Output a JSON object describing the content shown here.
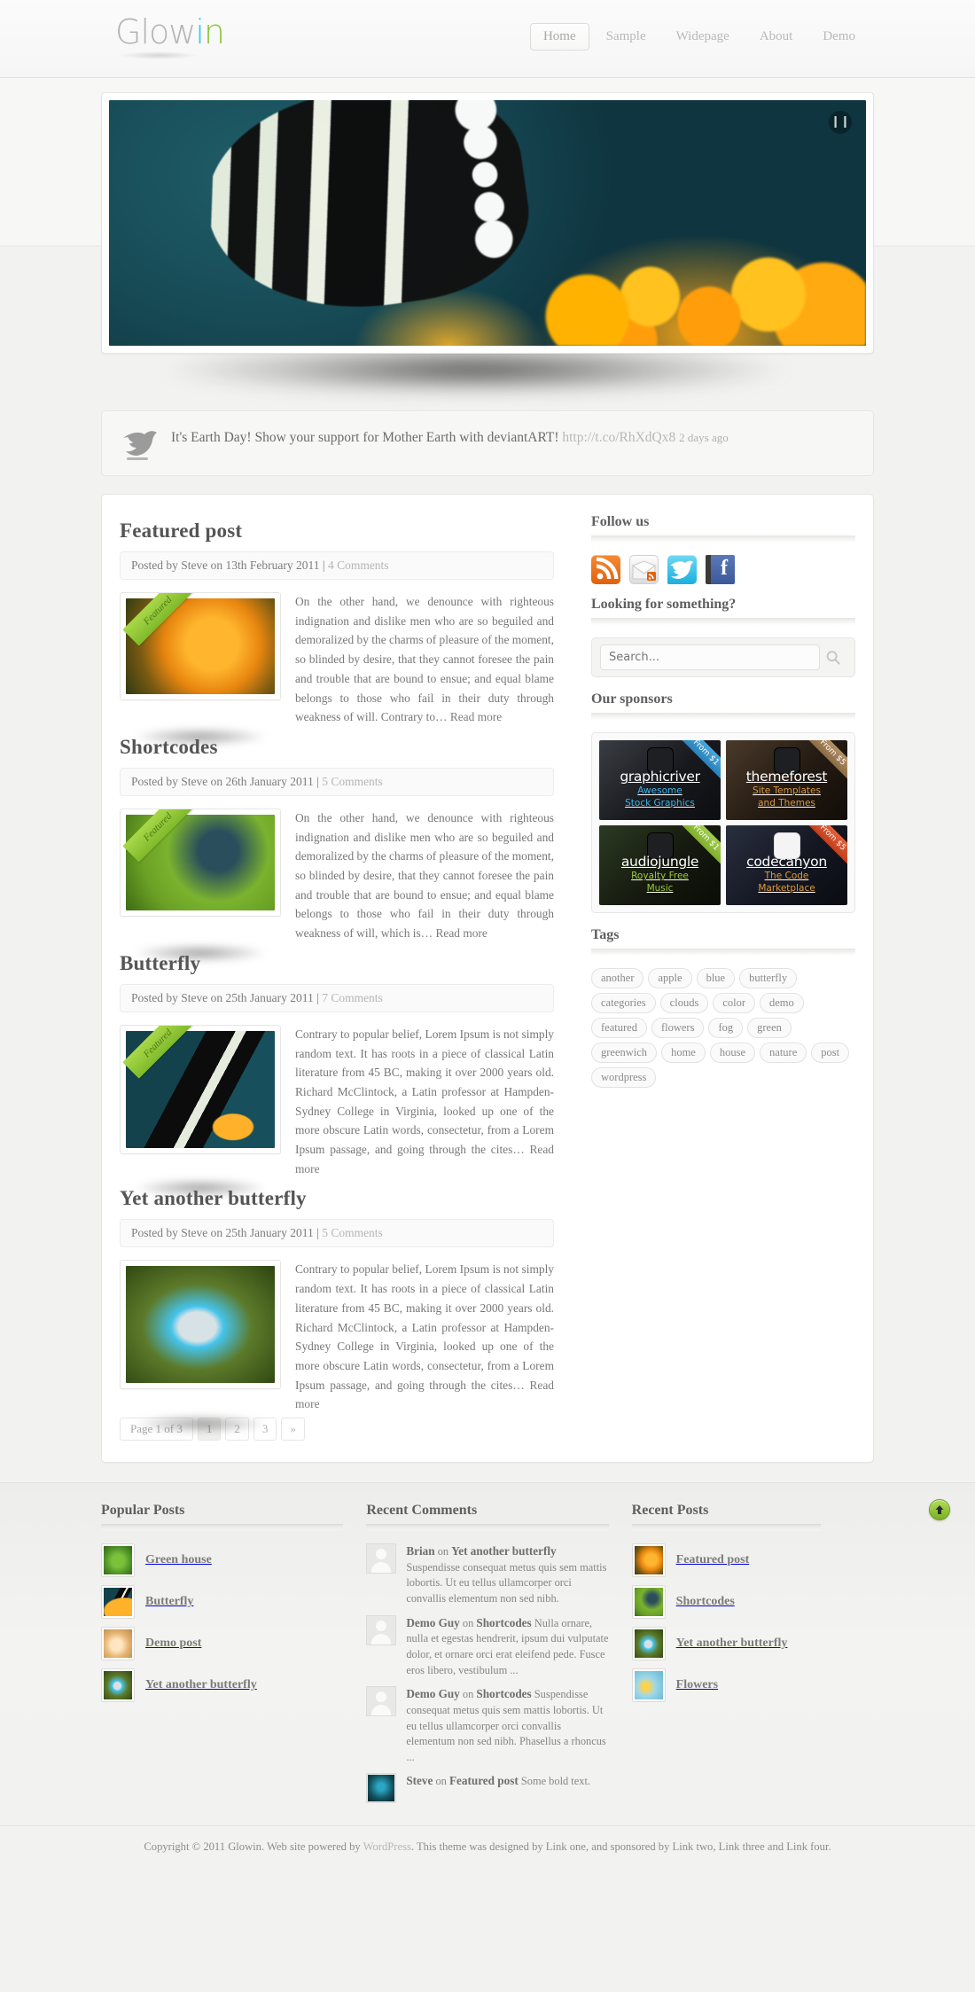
{
  "header": {
    "logo": {
      "part1": "Glow",
      "part2": "i",
      "part3": "n"
    },
    "nav": [
      {
        "label": "Home",
        "active": true
      },
      {
        "label": "Sample",
        "active": false
      },
      {
        "label": "Widepage",
        "active": false
      },
      {
        "label": "About",
        "active": false
      },
      {
        "label": "Demo",
        "active": false
      }
    ]
  },
  "slider": {
    "pause_icon": "pause-icon",
    "alt": "butterfly-on-orange-flowers"
  },
  "tweet": {
    "icon": "twitter-bird-icon",
    "text": "It's Earth Day! Show your support for Mother Earth with deviantART!",
    "link": "http://t.co/RhXdQx8",
    "ago": "2 days ago"
  },
  "posts": [
    {
      "title": "Featured post",
      "meta": "Posted by Steve on 13th February 2011 |",
      "comments": "4 Comments",
      "ribbon": "Featured",
      "image_class": "img-flower",
      "excerpt": "On the other hand, we denounce with righteous indignation and dislike men who are so beguiled and demoralized by the charms of pleasure of the moment, so blinded by desire, that they cannot foresee the pain and trouble that are bound to ensue; and equal blame belongs to those who fail in their duty through weakness of will. Contrary to…",
      "read_more": "Read more"
    },
    {
      "title": "Shortcodes",
      "meta": "Posted by Steve on 26th January 2011 |",
      "comments": "5 Comments",
      "ribbon": "Featured",
      "image_class": "img-fly",
      "excerpt": "On the other hand, we denounce with righteous indignation and dislike men who are so beguiled and demoralized by the charms of pleasure of the moment, so blinded by desire, that they cannot foresee the pain and trouble that are bound to ensue; and equal blame belongs to those who fail in their duty through weakness of will, which is…",
      "read_more": "Read more"
    },
    {
      "title": "Butterfly",
      "meta": "Posted by Steve on 25th January 2011 |",
      "comments": "7 Comments",
      "ribbon": "Featured",
      "image_class": "img-bfly",
      "excerpt": "Contrary to popular belief, Lorem Ipsum is not simply random text. It has roots in a piece of classical Latin literature from 45 BC, making it over 2000 years old. Richard McClintock, a Latin professor at Hampden-Sydney College in Virginia, looked up one of the more obscure Latin words, consectetur, from a Lorem Ipsum passage, and going through the cites…",
      "read_more": "Read more"
    },
    {
      "title": "Yet another butterfly",
      "meta": "Posted by Steve on 25th January 2011 |",
      "comments": "5 Comments",
      "ribbon": "",
      "image_class": "img-bfly2",
      "excerpt": "Contrary to popular belief, Lorem Ipsum is not simply random text. It has roots in a piece of classical Latin literature from 45 BC, making it over 2000 years old. Richard McClintock, a Latin professor at Hampden-Sydney College in Virginia, looked up one of the more obscure Latin words, consectetur, from a Lorem Ipsum passage, and going through the cites…",
      "read_more": "Read more"
    }
  ],
  "pagination": {
    "label": "Page 1 of 3",
    "pages": [
      "1",
      "2",
      "3"
    ],
    "current": "1",
    "next": "»"
  },
  "sidebar": {
    "follow_heading": "Follow us",
    "social": [
      {
        "name": "rss-icon",
        "label": "RSS"
      },
      {
        "name": "email-icon",
        "label": "Email"
      },
      {
        "name": "twitter-icon",
        "label": "Twitter"
      },
      {
        "name": "facebook-icon",
        "label": "Facebook"
      }
    ],
    "search_heading": "Looking for something?",
    "search_placeholder": "Search...",
    "search_value": "",
    "search_icon": "magnifier-icon",
    "sponsors_heading": "Our sponsors",
    "sponsors": [
      {
        "name": "graphicriver",
        "tagline": "Awesome\nStock Graphics",
        "tagline1": "Awesome",
        "tagline2": "Stock Graphics",
        "badge": "From $1"
      },
      {
        "name": "themeforest",
        "tagline1": "Site Templates",
        "tagline2": "and Themes",
        "badge": "From $5"
      },
      {
        "name": "audiojungle",
        "tagline1": "Royalty Free",
        "tagline2": "Music",
        "badge": "From $1"
      },
      {
        "name": "codecanyon",
        "tagline1": "The Code",
        "tagline2": "Marketplace",
        "badge": "From $5"
      }
    ],
    "tags_heading": "Tags",
    "tags": [
      "another",
      "apple",
      "blue",
      "butterfly",
      "categories",
      "clouds",
      "color",
      "demo",
      "featured",
      "flowers",
      "fog",
      "green",
      "greenwich",
      "home",
      "house",
      "nature",
      "post",
      "wordpress"
    ]
  },
  "footer": {
    "popular_heading": "Popular Posts",
    "popular": [
      {
        "title": "Green house",
        "image_class": "img-house"
      },
      {
        "title": "Butterfly",
        "image_class": "img-bfly"
      },
      {
        "title": "Demo post",
        "image_class": "img-demo"
      },
      {
        "title": "Yet another butterfly",
        "image_class": "img-bfly2"
      }
    ],
    "comments_heading": "Recent Comments",
    "comments": [
      {
        "author": "Brian",
        "on": "on",
        "post": "Yet another butterfly",
        "text": "Suspendisse consequat metus quis sem mattis lobortis. Ut eu tellus ullamcorper orci convallis elementum non sed nibh.",
        "avatar": "placeholder"
      },
      {
        "author": "Demo Guy",
        "on": "on",
        "post": "Shortcodes",
        "text": "Nulla ornare, nulla et egestas hendrerit, ipsum dui vulputate dolor, et ornare orci erat eleifend pede. Fusce eros libero, vestibulum ...",
        "avatar": "placeholder"
      },
      {
        "author": "Demo Guy",
        "on": "on",
        "post": "Shortcodes",
        "text": "Suspendisse consequat metus quis sem mattis lobortis. Ut eu tellus ullamcorper orci convallis elementum non sed nibh. Phasellus a rhoncus ...",
        "avatar": "placeholder"
      },
      {
        "author": "Steve",
        "on": "on",
        "post": "Featured post",
        "text": "Some bold text.",
        "avatar": "img-steve"
      }
    ],
    "recent_heading": "Recent Posts",
    "recent": [
      {
        "title": "Featured post",
        "image_class": "img-flower"
      },
      {
        "title": "Shortcodes",
        "image_class": "img-fly"
      },
      {
        "title": "Yet another butterfly",
        "image_class": "img-bfly2"
      },
      {
        "title": "Flowers",
        "image_class": "img-flowers"
      }
    ],
    "scroll_top_icon": "arrow-up-icon",
    "copyright_1": "Copyright © 2011 Glowin. Web site powered by ",
    "copyright_link": "WordPress",
    "copyright_2": ". This theme was designed by Link one, and sponsored by Link two, Link three and Link four."
  },
  "colors": {
    "accent_green": "#8dc63f",
    "accent_cyan": "#38c8ef",
    "text": "#6f6f6f",
    "bg": "#f2f2f0"
  }
}
